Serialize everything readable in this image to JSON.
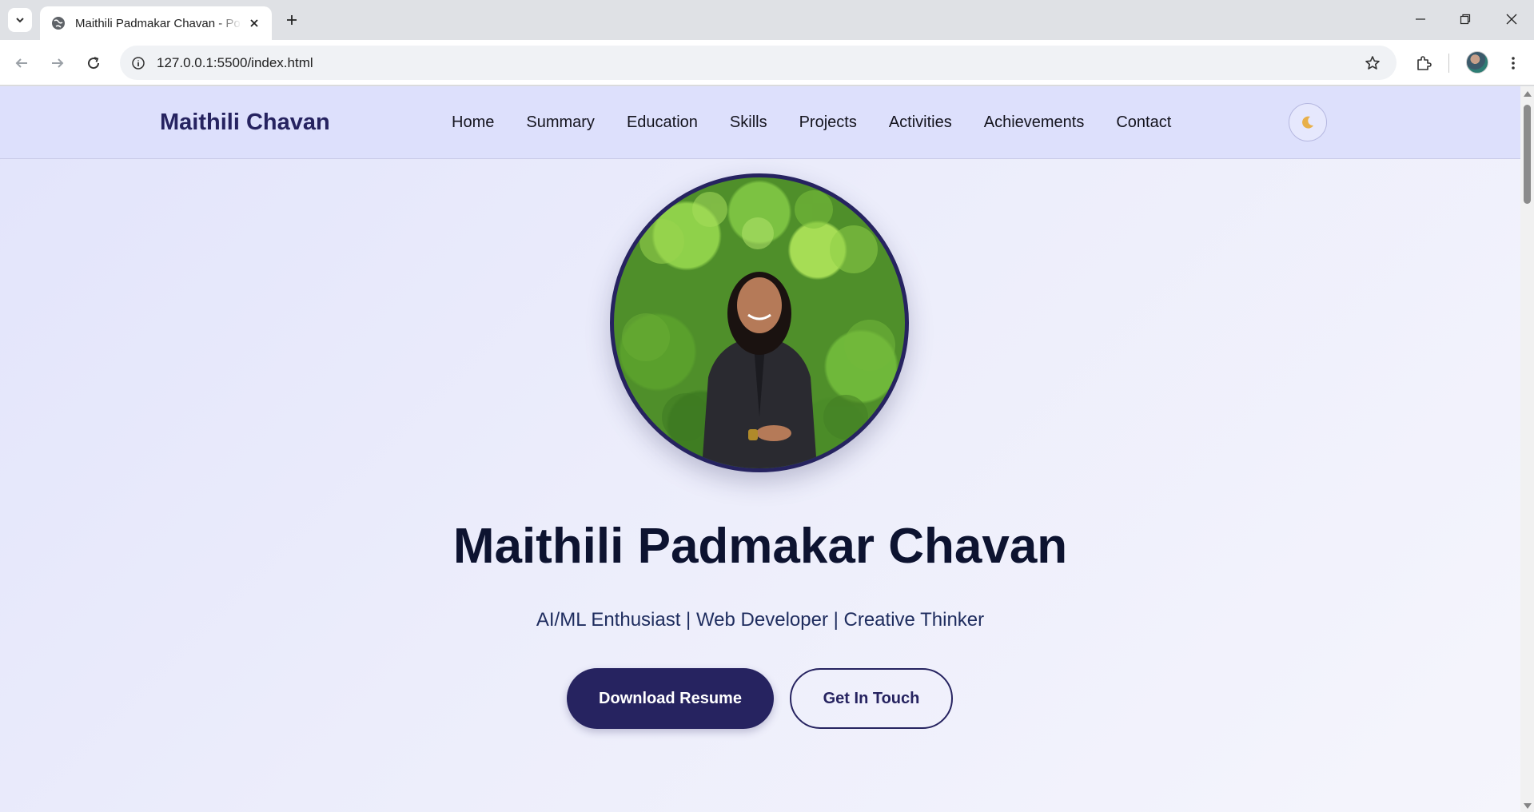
{
  "browser": {
    "tab_title": "Maithili Padmakar Chavan - Portfolio",
    "url": "127.0.0.1:5500/index.html"
  },
  "site": {
    "brand": "Maithili Chavan",
    "nav": [
      {
        "label": "Home"
      },
      {
        "label": "Summary"
      },
      {
        "label": "Education"
      },
      {
        "label": "Skills"
      },
      {
        "label": "Projects"
      },
      {
        "label": "Activities"
      },
      {
        "label": "Achievements"
      },
      {
        "label": "Contact"
      }
    ],
    "theme_toggle_icon": "moon-icon"
  },
  "hero": {
    "name": "Maithili Padmakar Chavan",
    "tagline": "AI/ML Enthusiast | Web Developer | Creative Thinker",
    "primary_button": "Download Resume",
    "secondary_button": "Get In Touch"
  },
  "colors": {
    "brand": "#262360",
    "nav_bg": "#dde0fc",
    "page_bg": "#e8e9fb"
  }
}
